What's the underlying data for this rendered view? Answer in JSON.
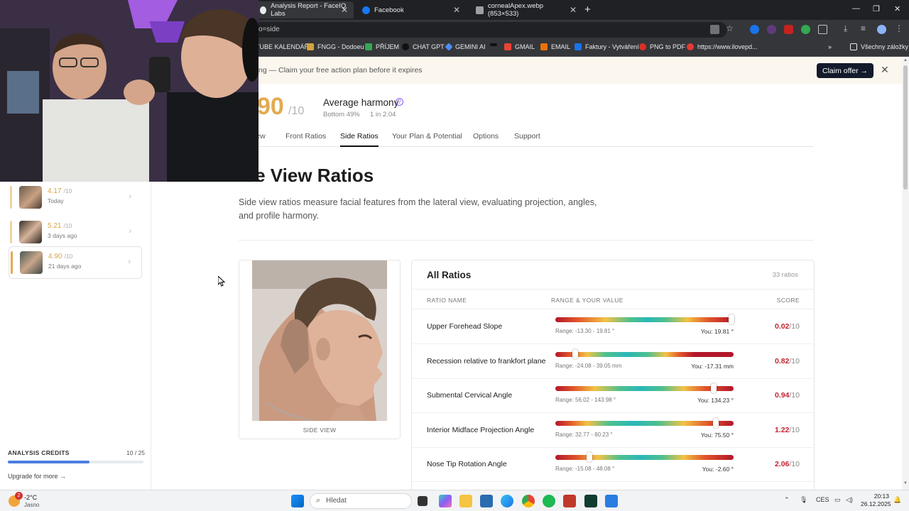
{
  "browser": {
    "tabs": [
      {
        "title": "Analysis Report - FaceIQ Labs",
        "active": true
      },
      {
        "title": "Facebook",
        "active": false
      },
      {
        "title": "cornealApex.webp (853×533)",
        "active": false
      }
    ],
    "url": "o=side",
    "bookmarks": [
      "TUBE KALENDÁŘ",
      "FNGG - Dodoeu",
      "PŘÍJEM",
      "CHAT GPT",
      "GEMINI AI",
      "GMAIL",
      "EMAIL",
      "Faktury - Vytváření",
      "PNG to PDF",
      "https://www.ilovepd...",
      "Všechny záložky"
    ]
  },
  "promo": {
    "text": "ng — Claim your free action plan before it expires",
    "cta": "Claim offer →",
    "close": "✕"
  },
  "sidebar": {
    "history": [
      {
        "score": "4.17",
        "denom": "/10",
        "when": "Today"
      },
      {
        "score": "5.21",
        "denom": "/10",
        "when": "3 days ago"
      },
      {
        "score": "4.90",
        "denom": "/10",
        "when": "21 days ago"
      }
    ],
    "credits": {
      "label": "ANALYSIS CREDITS",
      "count": "10 / 25",
      "used_fraction": 0.6
    },
    "upgrade": "Upgrade for more →"
  },
  "summary": {
    "score": "90",
    "denom": "/10",
    "title": "Average harmony",
    "help": "?",
    "bottom": "Bottom 49%",
    "one_in": "1 in 2.04"
  },
  "tabs": [
    "iew",
    "Front Ratios",
    "Side Ratios",
    "Your Plan & Potential",
    "Options",
    "Support"
  ],
  "page": {
    "title": "ide View Ratios",
    "description": "Side view ratios measure facial features from the lateral view, evaluating projection, angles, and profile harmony."
  },
  "photo_card": {
    "label": "SIDE VIEW"
  },
  "ratios": {
    "title": "All Ratios",
    "count": "33 ratios",
    "headers": {
      "name": "RATIO NAME",
      "range": "RANGE & YOUR VALUE",
      "score": "SCORE"
    },
    "rows": [
      {
        "name": "Upper Forehead Slope",
        "range": "Range: -13.30 - 19.81 °",
        "you": "You: 19.81 °",
        "score": "0.02",
        "denom": "/10",
        "position": 0.99,
        "gradient": "linear-gradient(90deg,#b3162a 0%,#e0552b 12%,#f3c244 28%,#4fc08d 42%,#29b8b8 52%,#4fc08d 62%,#f3c244 74%,#e0552b 86%,#b3162a 100%)"
      },
      {
        "name": "Recession relative to frankfort plane",
        "range": "Range: -24.08 - 39.05 mm",
        "you": "You: -17.31 mm",
        "score": "0.82",
        "denom": "/10",
        "position": 0.11,
        "gradient": "linear-gradient(90deg,#b3162a 0%,#e0552b 8%,#f3c244 18%,#4fc08d 28%,#29b8b8 40%,#4fc08d 52%,#f3c244 62%,#e0552b 70%,#b3162a 78%,#b3162a 100%)"
      },
      {
        "name": "Submental Cervical Angle",
        "range": "Range: 56.02 - 143.98 °",
        "you": "You: 134.23 °",
        "score": "0.94",
        "denom": "/10",
        "position": 0.89,
        "gradient": "linear-gradient(90deg,#b3162a 0%,#e0552b 10%,#f3c244 22%,#4fc08d 36%,#29b8b8 48%,#4fc08d 60%,#f3c244 72%,#e0552b 84%,#b3162a 100%)"
      },
      {
        "name": "Interior Midface Projection Angle",
        "range": "Range: 32.77 - 80.23 °",
        "you": "You: 75.50 °",
        "score": "1.22",
        "denom": "/10",
        "position": 0.9,
        "gradient": "linear-gradient(90deg,#b3162a 0%,#e0552b 8%,#f3c244 18%,#4fc08d 30%,#29b8b8 44%,#4fc08d 58%,#f3c244 72%,#e0552b 86%,#b3162a 100%)"
      },
      {
        "name": "Nose Tip Rotation Angle",
        "range": "Range: -15.08 - 48.08 °",
        "you": "You: -2.60 °",
        "score": "2.06",
        "denom": "/10",
        "position": 0.19,
        "gradient": "linear-gradient(90deg,#b3162a 0%,#e0552b 12%,#f3c244 24%,#4fc08d 36%,#29b8b8 48%,#4fc08d 60%,#f3c244 72%,#e0552b 84%,#b3162a 100%)"
      }
    ]
  },
  "taskbar": {
    "weather_badge": "2",
    "temp": "-2°C",
    "condition": "Jasno",
    "search": "Hledat",
    "lang": "CES",
    "time": "20:13",
    "date": "26.12.2025"
  },
  "colors": {
    "accent_gold": "#e3aa50",
    "score_red": "#c3222f",
    "cta_navy": "#131a2c"
  }
}
